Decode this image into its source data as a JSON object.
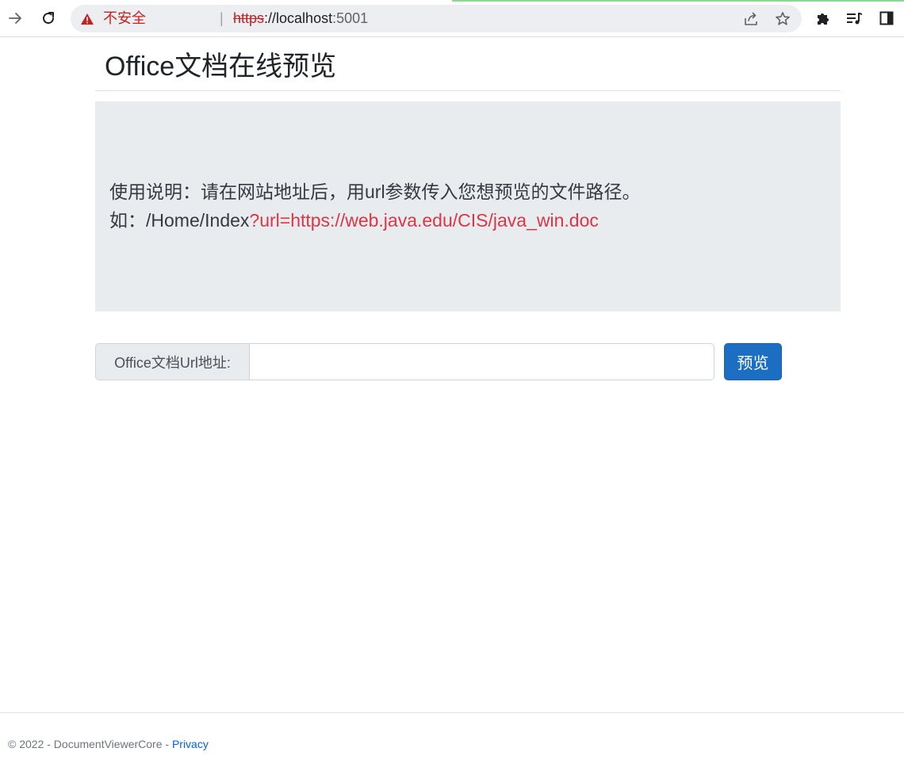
{
  "browser": {
    "security_label": "不安全",
    "separator": "|",
    "url_scheme": "https",
    "url_rest": "://localhost",
    "url_port": ":5001"
  },
  "header": {
    "title": "Office文档在线预览"
  },
  "instructions": {
    "line1": "使用说明：请在网站地址后，用url参数传入您想预览的文件路径。",
    "line2_prefix": "如：/Home/Index",
    "line2_highlight": "?url=https://web.java.edu/CIS/java_win.doc"
  },
  "form": {
    "label": "Office文档Url地址:",
    "input_value": "",
    "button_label": "预览"
  },
  "footer": {
    "copyright": "© 2022 - DocumentViewerCore - ",
    "privacy_link": "Privacy"
  },
  "colors": {
    "primary_button": "#1b6ec2",
    "highlight_red": "#dc3545",
    "insecure_red": "#c5221f"
  }
}
